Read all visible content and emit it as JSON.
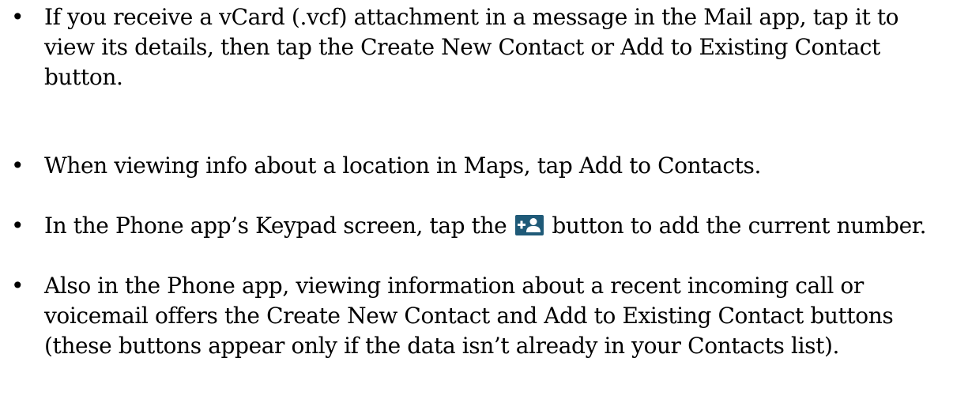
{
  "bullet_glyph": "•",
  "items": [
    {
      "text": "If you receive a vCard (.vcf) attachment in a message in the Mail app, tap it to view its details, then tap the Create New Contact or Add to Existing Contact button."
    },
    {
      "text": "When viewing info about a location in Maps, tap Add to Contacts."
    },
    {
      "text_before": "In the Phone app’s Keypad screen, tap the ",
      "icon": "add-contact-icon",
      "text_after": " button to add the current number."
    },
    {
      "text": "Also in the Phone app, viewing information about a recent incoming call or voicemail offers the Create New Contact and Add to Existing Contact buttons (these buttons appear only if the data isn’t already in your Contacts list)."
    }
  ],
  "colors": {
    "text": "#000000",
    "background": "#ffffff",
    "icon_bg": "#1f5a78",
    "icon_fg": "#ffffff"
  }
}
